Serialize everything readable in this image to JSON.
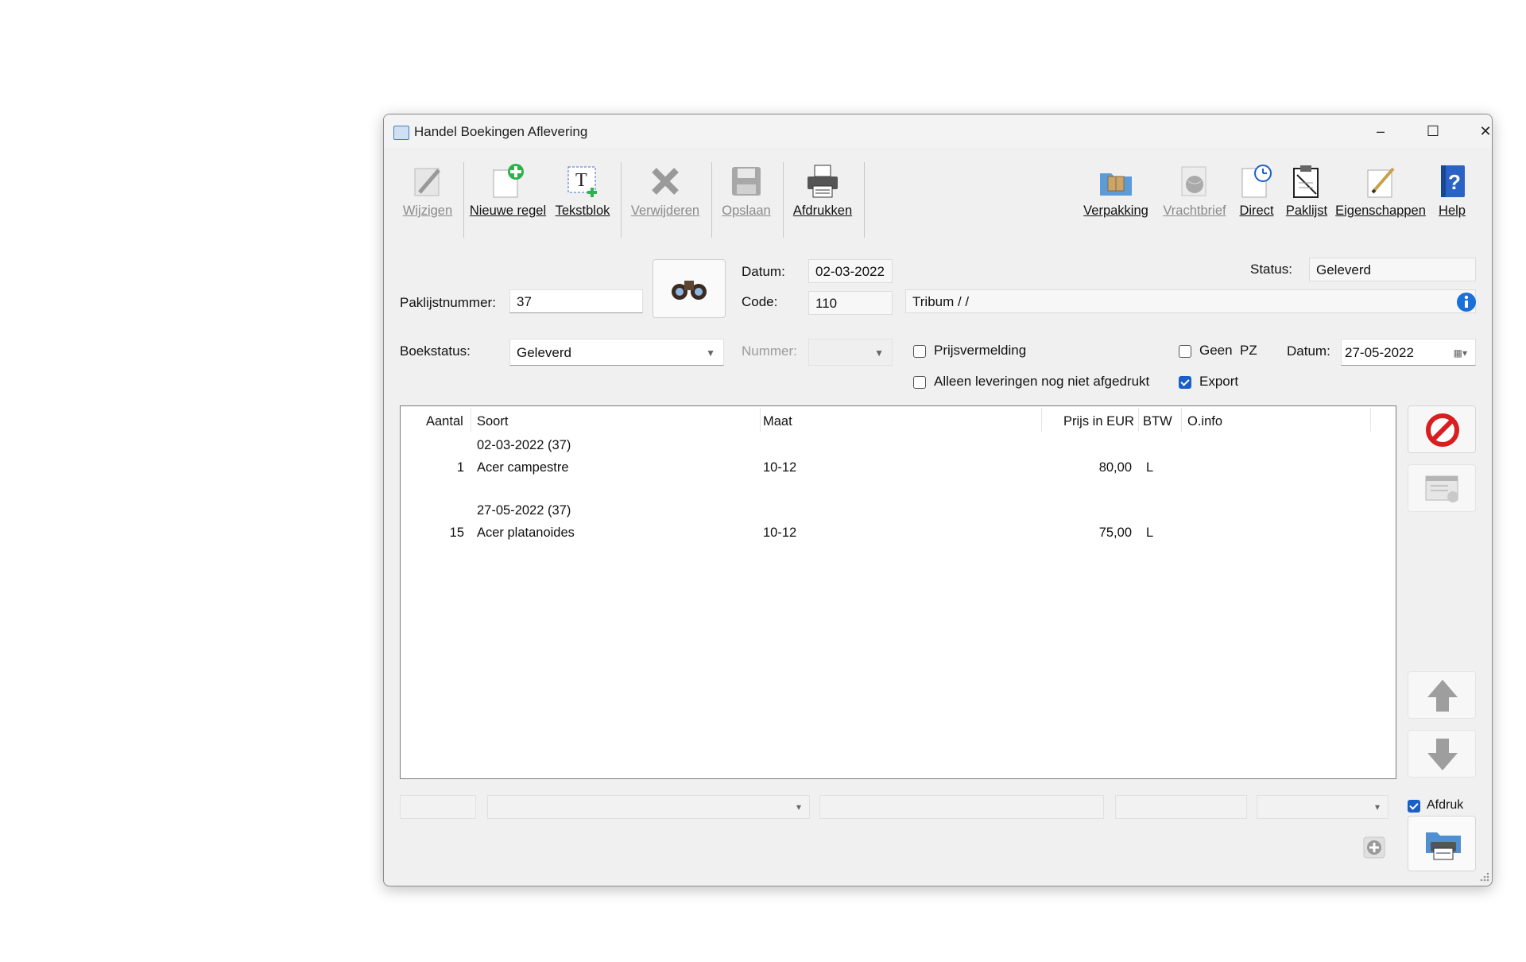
{
  "window": {
    "title": "Handel Boekingen Aflevering",
    "minimize": "–",
    "maximize": "☐",
    "close": "✕"
  },
  "toolbar": {
    "wijzigen": "Wijzigen",
    "nieuwe_regel": "Nieuwe regel",
    "tekstblok": "Tekstblok",
    "verwijderen": "Verwijderen",
    "opslaan": "Opslaan",
    "afdrukken": "Afdrukken",
    "verpakking": "Verpakking",
    "vrachtbrief": "Vrachtbrief",
    "direct": "Direct",
    "paklijst": "Paklijst",
    "eigenschappen": "Eigenschappen",
    "help": "Help"
  },
  "form": {
    "paklijstnummer_label": "Paklijstnummer:",
    "paklijstnummer": "37",
    "datum_label": "Datum:",
    "datum": "02-03-2022",
    "code_label": "Code:",
    "code": "110",
    "relatie": "Tribum /  /",
    "status_label": "Status:",
    "status": "Geleverd",
    "boekstatus_label": "Boekstatus:",
    "boekstatus": "Geleverd",
    "nummer_label": "Nummer:",
    "nummer": "",
    "prijsvermelding_label": "Prijsvermelding",
    "prijsvermelding": false,
    "alleen_label": "Alleen leveringen nog niet afgedrukt",
    "alleen": false,
    "geen_pz_label": "Geen  PZ",
    "geen_pz": false,
    "export_label": "Export",
    "export": true,
    "datum2_label": "Datum:",
    "datum2": "27-05-2022"
  },
  "grid": {
    "headers": {
      "aantal": "Aantal",
      "soort": "Soort",
      "maat": "Maat",
      "prijs": "Prijs in EUR",
      "btw": "BTW",
      "oinfo": "O.info"
    },
    "group1": {
      "date": "02-03-2022 (37)",
      "aantal": "1",
      "soort": "Acer campestre",
      "maat": "10-12",
      "prijs": "80,00",
      "btw": "L"
    },
    "group2": {
      "date": "27-05-2022 (37)",
      "aantal": "15",
      "soort": "Acer platanoides",
      "maat": "10-12",
      "prijs": "75,00",
      "btw": "L"
    }
  },
  "bottom": {
    "afdruk_label": "Afdruk",
    "afdruk": true
  }
}
